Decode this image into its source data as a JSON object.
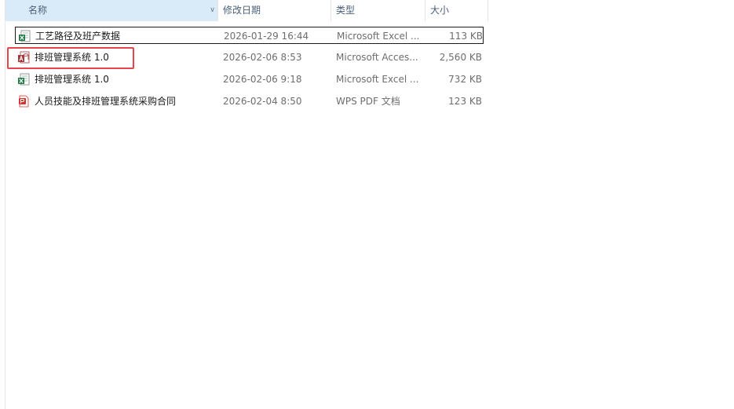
{
  "columns": {
    "name": "名称",
    "date": "修改日期",
    "type": "类型",
    "size": "大小"
  },
  "files": [
    {
      "name": "工艺路径及班产数据",
      "date": "2026-01-29 16:44",
      "type": "Microsoft Excel ...",
      "size": "113 KB",
      "icon": "excel-icon"
    },
    {
      "name": "排班管理系统 1.0",
      "date": "2026-02-06 8:53",
      "type": "Microsoft Acces...",
      "size": "2,560 KB",
      "icon": "access-icon"
    },
    {
      "name": "排班管理系统 1.0",
      "date": "2026-02-06 9:18",
      "type": "Microsoft Excel ...",
      "size": "732 KB",
      "icon": "excel-icon"
    },
    {
      "name": "人员技能及排班管理系统采购合同",
      "date": "2026-02-04 8:50",
      "type": "WPS PDF 文档",
      "size": "123 KB",
      "icon": "pdf-icon"
    }
  ],
  "colors": {
    "header_bg": "#d9ebf9",
    "highlight": "#e8454b",
    "excel_green": "#1f7a45",
    "access_red": "#a4373a",
    "pdf_red": "#d9302b"
  }
}
